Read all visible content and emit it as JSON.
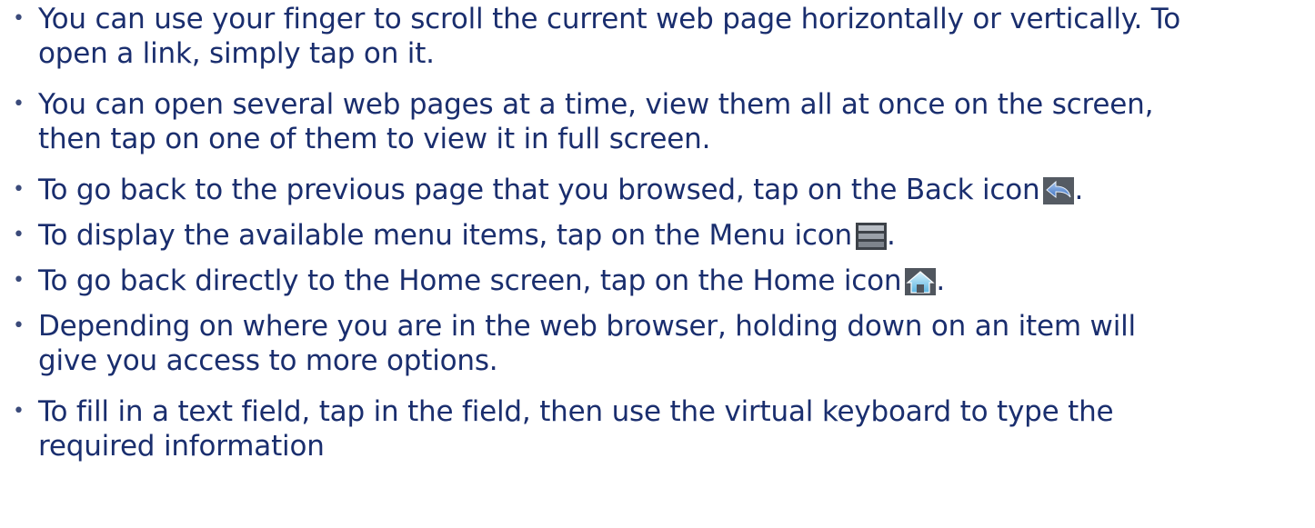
{
  "bullets": [
    {
      "marker": "•",
      "lines": [
        "You can use your finger to scroll the current web page horizontally or vertically. To",
        "open a link, simply tap on it."
      ]
    },
    {
      "marker": "•",
      "lines": [
        "You can open several web pages at a time, view them all at once on the screen,",
        "then tap on one of them to view it in full screen."
      ]
    },
    {
      "marker": "•",
      "text": "To go back to the previous page that you browsed, tap on the Back icon",
      "icon": "back-arrow-icon",
      "after": "."
    },
    {
      "marker": "•",
      "text": "To display the available menu items, tap on the Menu icon",
      "icon": "menu-icon",
      "after": "."
    },
    {
      "marker": "•",
      "text": "To go back directly to the Home screen, tap on the Home icon",
      "icon": "home-icon",
      "after": "."
    },
    {
      "marker": "•",
      "lines": [
        "Depending on where you are in the web browser, holding down on an item will",
        "give you access to more options."
      ]
    },
    {
      "marker": "•",
      "lines": [
        "To fill in a text field, tap in the field, then use the virtual keyboard to type the",
        "required information"
      ]
    }
  ],
  "colors": {
    "text": "#1a2e6e",
    "icon_back": "#5a8fd6",
    "icon_menu": "#8a9099",
    "icon_home": "#8fd0f0"
  }
}
